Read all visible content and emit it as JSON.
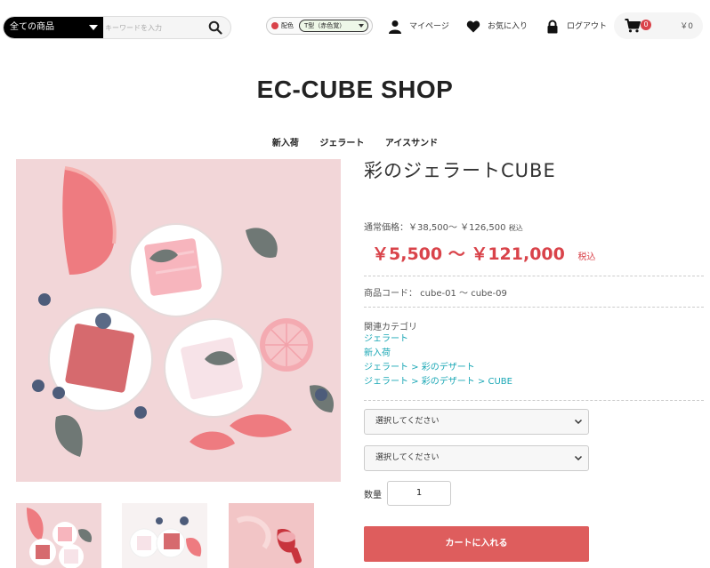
{
  "header": {
    "category_select": "全ての商品",
    "search_placeholder": "キーワードを入力",
    "scheme_label": "配色",
    "scheme_value": "T型（赤色覚）",
    "mypage": "マイページ",
    "favorites": "お気に入り",
    "logout": "ログアウト",
    "cart_count": "0",
    "cart_total": "￥0"
  },
  "shop_title": "EC-CUBE SHOP",
  "category_nav": [
    "新入荷",
    "ジェラート",
    "アイスサンド"
  ],
  "product": {
    "name": "彩のジェラートCUBE",
    "normal_price_label": "通常価格：￥38,500～ ￥126,500",
    "normal_price_tax": "税込",
    "price": "￥5,500 ～ ￥121,000",
    "price_tax": "税込",
    "code": "商品コード： cube-01 ～ cube-09",
    "related_title": "関連カテゴリ",
    "related_categories": [
      "ジェラート",
      "新入荷",
      "ジェラート > 彩のデザート",
      "ジェラート > 彩のデザート > CUBE"
    ],
    "select1": "選択してください",
    "select2": "選択してください",
    "qty_label": "数量",
    "qty_value": "1",
    "add_to_cart": "カートに入れる"
  },
  "colors": {
    "accent": "#de5d5d",
    "link": "#1aa7b5",
    "price": "#d9434a"
  },
  "icons": [
    "search-icon",
    "user-icon",
    "heart-icon",
    "lock-icon",
    "cart-icon",
    "chevron-down-icon"
  ]
}
